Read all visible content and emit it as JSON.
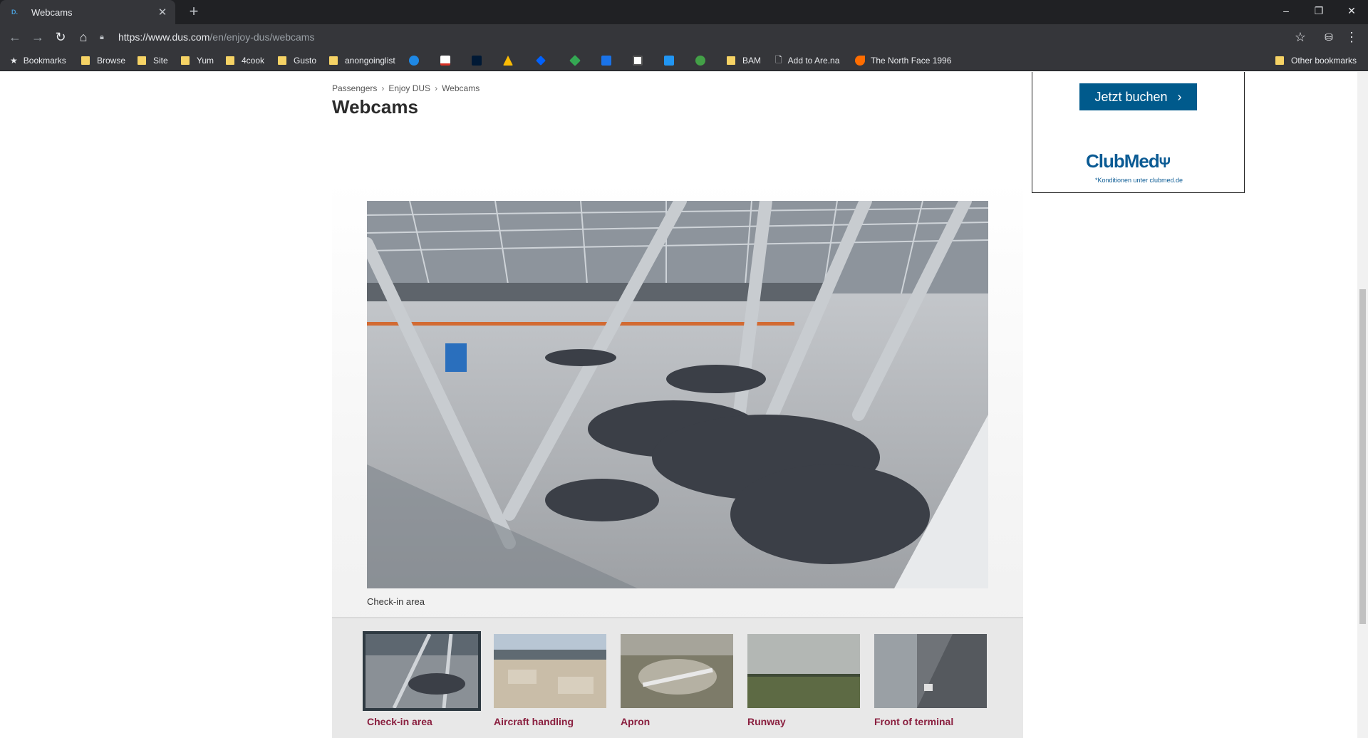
{
  "browser": {
    "tab_title": "Webcams",
    "favicon_text": "D.",
    "url_host": "https://www.dus.com",
    "url_path": "/en/enjoy-dus/webcams",
    "bookmarks": [
      {
        "label": "Bookmarks",
        "kind": "star"
      },
      {
        "label": "Browse",
        "kind": "folder"
      },
      {
        "label": "Site",
        "kind": "folder"
      },
      {
        "label": "Yum",
        "kind": "folder"
      },
      {
        "label": "4cook",
        "kind": "folder"
      },
      {
        "label": "Gusto",
        "kind": "folder"
      },
      {
        "label": "anongoinglist",
        "kind": "folder"
      },
      {
        "label": "BAM",
        "kind": "folder"
      },
      {
        "label": "Add to Are.na",
        "kind": "page"
      },
      {
        "label": "The North Face 1996",
        "kind": "site"
      },
      {
        "label": "Other bookmarks",
        "kind": "folder"
      }
    ]
  },
  "page": {
    "breadcrumb": [
      "Passengers",
      "Enjoy DUS",
      "Webcams"
    ],
    "title": "Webcams",
    "main_caption": "Check-in area",
    "thumbnails": [
      "Check-in area",
      "Aircraft handling",
      "Apron",
      "Runway",
      "Front of terminal"
    ]
  },
  "ad": {
    "button": "Jetzt buchen",
    "brand": "ClubMed",
    "fine_print": "*Konditionen unter clubmed.de"
  },
  "colors": {
    "accent_link": "#8a1f3f",
    "ad_blue": "#005a8c"
  }
}
